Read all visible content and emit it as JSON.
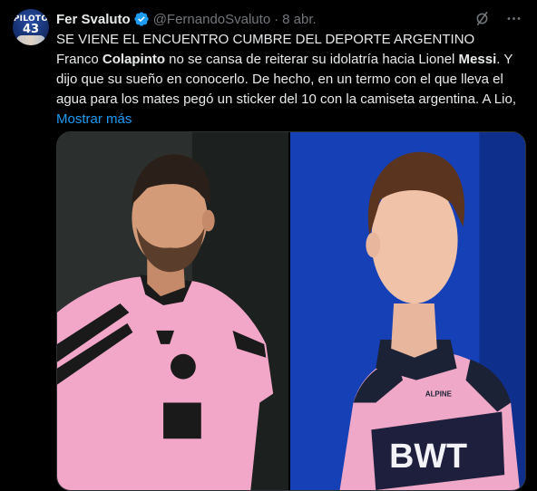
{
  "tweet": {
    "author": {
      "name": "Fer Svaluto",
      "handle": "@FernandoSvaluto",
      "date": "8 abr.",
      "avatar_text_top": "PILOTO",
      "avatar_text_number": "43",
      "verified_icon": "verified-badge-icon"
    },
    "actions": {
      "grok_icon": "grok-icon",
      "more_icon": "more-icon"
    },
    "text": {
      "line1": "SE VIENE EL ENCUENTRO CUMBRE DEL DEPORTE ARGENTINO",
      "line2_a": "Franco ",
      "line2_b": "Colapinto",
      "line2_c": " no se cansa de reiterar su idolatría hacia Lionel ",
      "line2_d": "Messi",
      "line2_e": ". Y",
      "line3": "dijo que su sueño en conocerlo. De hecho, en un termo con el que lleva el",
      "line4": "agua para los mates pegó un sticker del 10 con la camiseta argentina. A Lio,",
      "show_more": "Mostrar más"
    },
    "media": {
      "left_image": "messi-inter-miami-photo",
      "right_image": "colapinto-racing-suit-photo",
      "right_suit_text": "BWT",
      "right_suit_small": "ALPINE"
    },
    "colors": {
      "background": "#000000",
      "text": "#e7e9ea",
      "secondary": "#71767b",
      "link": "#1d9bf0",
      "verified": "#1d9bf0"
    }
  }
}
